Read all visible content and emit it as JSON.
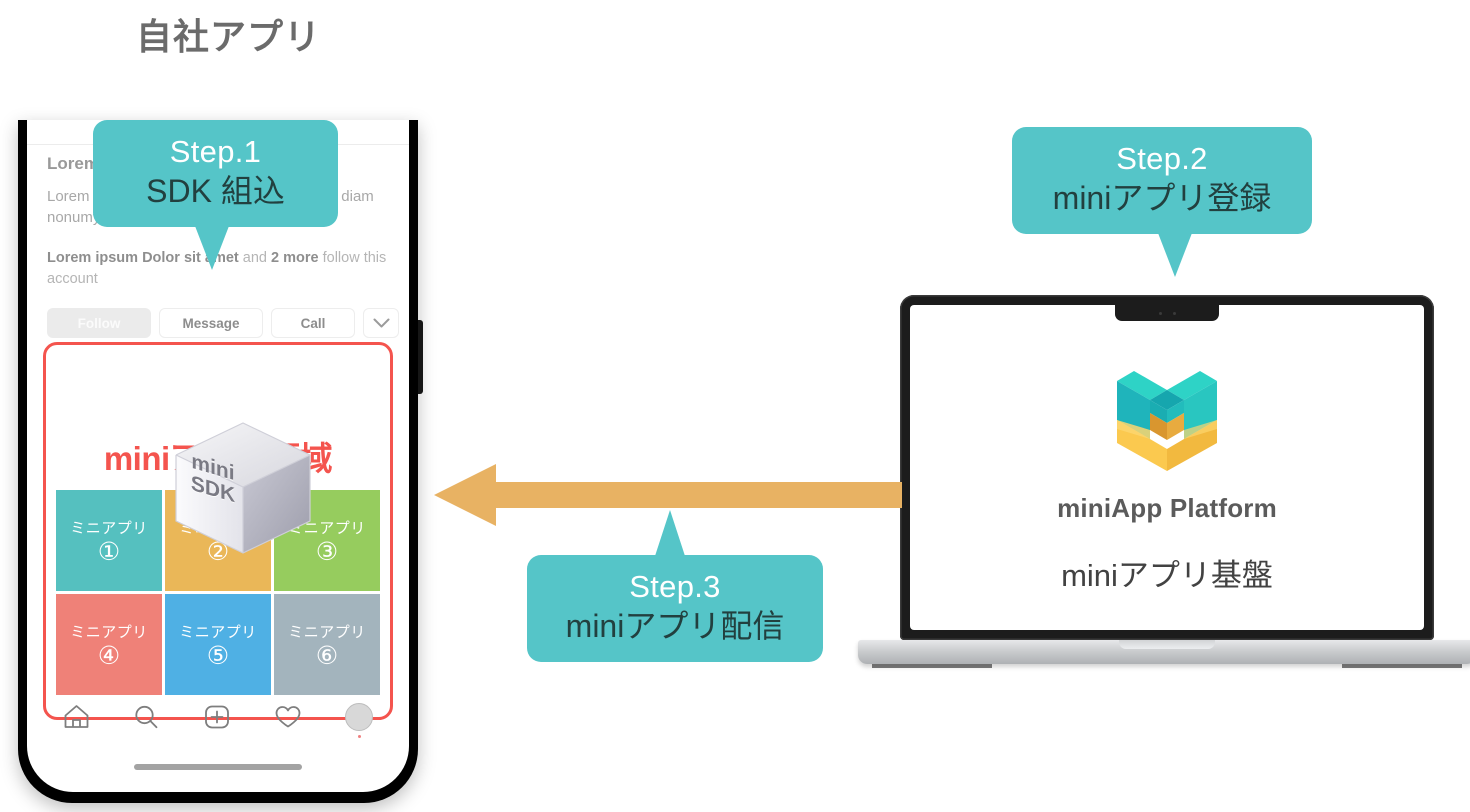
{
  "page": {
    "title": "自社アプリ"
  },
  "phone": {
    "feed": {
      "title": "Lorem ipsum",
      "body": "Lorem ipsum Dolor sit amet, consetetur sed diam nonumy eirmod",
      "follow_prefix": "Lorem ipsum Dolor sit amet",
      "follow_mid": " and ",
      "follow_count": "2 more",
      "follow_suffix": " follow this account",
      "actions": {
        "follow": "Follow",
        "message": "Message",
        "call": "Call",
        "more_icon": "chevron-down-icon"
      }
    },
    "mini_region": {
      "title": "miniアプリ領域",
      "tiles": [
        {
          "label": "ミニアプリ",
          "num": "①",
          "color": "#55c0bf"
        },
        {
          "label": "ミニアプリ",
          "num": "②",
          "color": "#eab758"
        },
        {
          "label": "ミニアプリ",
          "num": "③",
          "color": "#96cc5e"
        },
        {
          "label": "ミニアプリ",
          "num": "④",
          "color": "#ef8178"
        },
        {
          "label": "ミニアプリ",
          "num": "⑤",
          "color": "#4fb0e4"
        },
        {
          "label": "ミニアプリ",
          "num": "⑥",
          "color": "#a3b4bd"
        }
      ],
      "border_color": "#f4544e",
      "title_color": "#f4544e"
    },
    "sdk_cube": {
      "line1": "mini",
      "line2": "SDK"
    },
    "nav": {
      "items": [
        {
          "icon": "home-icon"
        },
        {
          "icon": "search-icon"
        },
        {
          "icon": "plus-square-icon"
        },
        {
          "icon": "heart-icon"
        },
        {
          "icon": "avatar-icon"
        }
      ]
    }
  },
  "laptop": {
    "brand_name": "miniApp Platform",
    "brand_sub": "miniアプリ基盤",
    "logo_icon": "miniapp-heart-logo",
    "logo_colors": {
      "teal_light": "#2ecfc4",
      "teal_mid": "#23bdbd",
      "teal_dark": "#1aa3ad",
      "yellow_light": "#fcd069",
      "yellow_mid": "#f8c651",
      "yellow_dark": "#dfa03c"
    }
  },
  "callouts": [
    {
      "id": "step1",
      "step": "Step.1",
      "desc": "SDK 組込"
    },
    {
      "id": "step2",
      "step": "Step.2",
      "desc": "miniアプリ登録"
    },
    {
      "id": "step3",
      "step": "Step.3",
      "desc": "miniアプリ配信"
    }
  ],
  "colors": {
    "callout_bg": "#55c5c8",
    "callout_step_text": "#ffffff",
    "callout_desc_text": "#22403f",
    "arrow": "#e8b263",
    "title_text": "#6b6b6b"
  }
}
